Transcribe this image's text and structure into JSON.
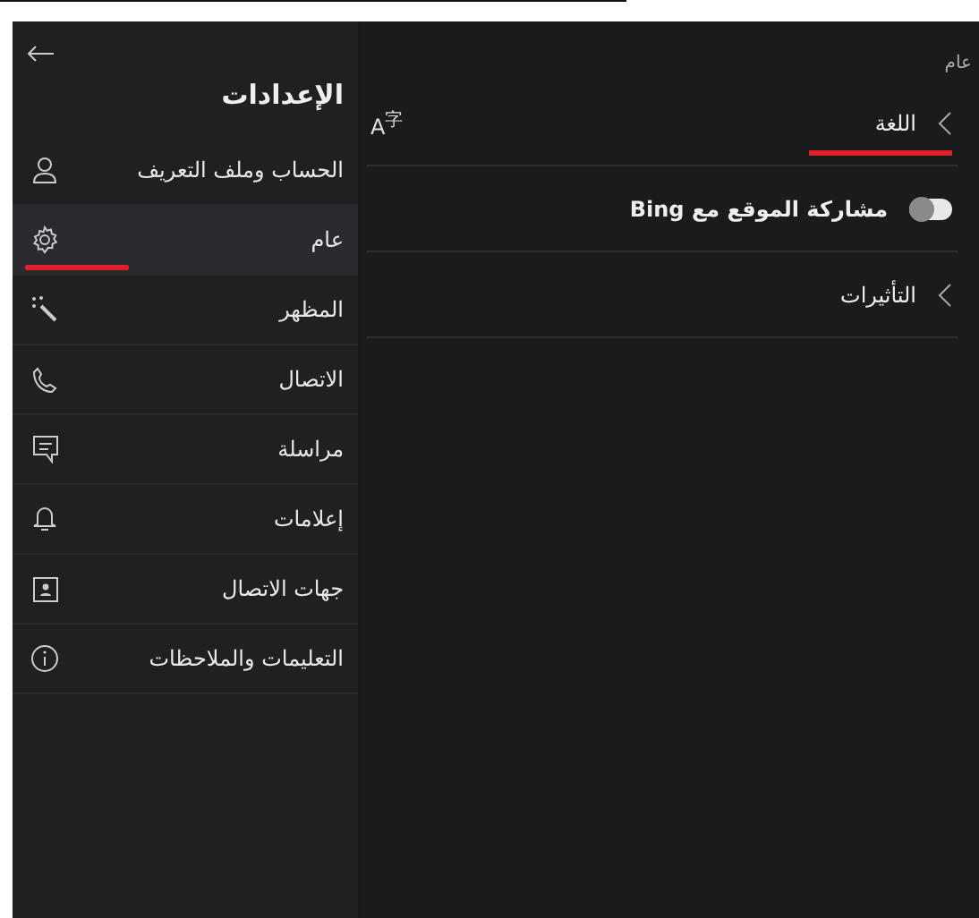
{
  "sidebar": {
    "title": "الإعدادات",
    "items": [
      {
        "label": "الحساب وملف التعريف",
        "selected": false
      },
      {
        "label": "عام",
        "selected": true
      },
      {
        "label": "المظهر",
        "selected": false
      },
      {
        "label": "الاتصال",
        "selected": false
      },
      {
        "label": "مراسلة",
        "selected": false
      },
      {
        "label": "إعلامات",
        "selected": false
      },
      {
        "label": "جهات الاتصال",
        "selected": false
      },
      {
        "label": "التعليمات والملاحظات",
        "selected": false
      }
    ]
  },
  "content": {
    "heading": "عام",
    "rows": [
      {
        "kind": "link",
        "label": "اللغة",
        "highlighted": true,
        "icon_text": "A$^{字}$"
      },
      {
        "kind": "toggle",
        "label": "مشاركة الموقع مع Bing",
        "on": false
      },
      {
        "kind": "link",
        "label": "التأثيرات",
        "highlighted": false
      }
    ]
  }
}
